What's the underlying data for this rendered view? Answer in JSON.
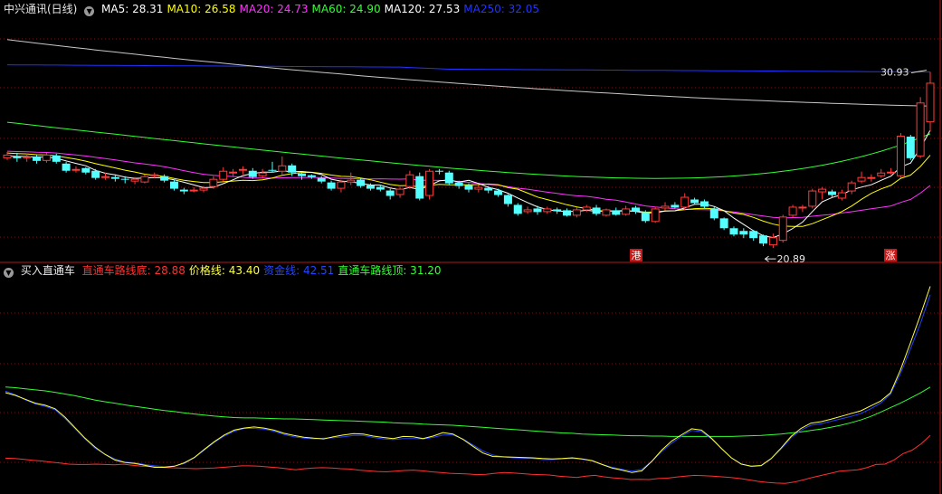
{
  "panel1": {
    "title": "中兴通讯(日线)",
    "ma": [
      {
        "label": "MA5: 28.31",
        "color": "#ffffff"
      },
      {
        "label": "MA10: 26.58",
        "color": "#ffff00"
      },
      {
        "label": "MA20: 24.73",
        "color": "#ff33ff"
      },
      {
        "label": "MA60: 24.90",
        "color": "#33ff33"
      },
      {
        "label": "MA120: 27.53",
        "color": "#ffffff"
      },
      {
        "label": "MA250: 32.05",
        "color": "#2233ff"
      }
    ],
    "high_marker": "30.93",
    "low_marker": "20.89",
    "badge_a": "港",
    "badge_b": "涨"
  },
  "panel2": {
    "title": "买入直通车",
    "lines": [
      {
        "label": "直通车路线底: 28.88",
        "color": "#ff3030"
      },
      {
        "label": "价格线: 43.40",
        "color": "#ffff44"
      },
      {
        "label": "资金线: 42.51",
        "color": "#2244ff"
      },
      {
        "label": "直通车路线顶: 31.20",
        "color": "#33ff33"
      }
    ]
  },
  "colors": {
    "up": "#ff3b3b",
    "down": "#54ffff",
    "grid": "#7a1010",
    "separator": "#b01818",
    "ma5": "#ffffff",
    "ma10": "#ffff00",
    "ma20": "#ff33ff",
    "ma60": "#33ff33",
    "ma120": "#c8c8c8",
    "ma250": "#2233ff",
    "route_bottom": "#ff3030",
    "price_line": "#ffff44",
    "money_line": "#2244ff",
    "route_top": "#33ff33"
  },
  "chart_data": [
    {
      "type": "candlestick",
      "title": "中兴通讯(日线)",
      "ylim": [
        19.5,
        33.0
      ],
      "candles": [
        [
          25.2,
          25.4,
          25.55,
          25.1
        ],
        [
          25.3,
          25.2,
          25.5,
          25.0
        ],
        [
          25.2,
          25.3,
          25.45,
          25.0
        ],
        [
          25.3,
          25.05,
          25.4,
          24.9
        ],
        [
          25.05,
          25.4,
          25.5,
          24.95
        ],
        [
          25.35,
          25.0,
          25.45,
          24.9
        ],
        [
          24.9,
          24.5,
          25.0,
          24.4
        ],
        [
          24.5,
          24.6,
          24.75,
          24.4
        ],
        [
          24.65,
          24.4,
          24.7,
          24.3
        ],
        [
          24.5,
          24.1,
          24.6,
          24.0
        ],
        [
          24.1,
          24.2,
          24.4,
          24.0
        ],
        [
          24.15,
          24.05,
          24.3,
          23.9
        ],
        [
          24.05,
          24.0,
          24.2,
          23.8
        ],
        [
          23.9,
          24.05,
          24.15,
          23.75
        ],
        [
          23.85,
          24.2,
          24.3,
          23.8
        ],
        [
          24.2,
          24.3,
          24.4,
          24.1
        ],
        [
          24.2,
          23.95,
          24.3,
          23.85
        ],
        [
          23.9,
          23.5,
          24.0,
          23.4
        ],
        [
          23.45,
          23.35,
          23.55,
          23.2
        ],
        [
          23.35,
          23.45,
          23.6,
          23.3
        ],
        [
          23.4,
          23.55,
          23.65,
          23.3
        ],
        [
          23.6,
          24.05,
          24.2,
          23.5
        ],
        [
          24.0,
          24.5,
          24.7,
          23.9
        ],
        [
          24.4,
          24.45,
          24.6,
          24.2
        ],
        [
          24.55,
          24.6,
          24.75,
          24.3
        ],
        [
          24.5,
          24.15,
          24.65,
          24.05
        ],
        [
          24.2,
          24.4,
          24.6,
          24.1
        ],
        [
          24.55,
          24.5,
          25.0,
          24.4
        ],
        [
          24.45,
          24.8,
          25.3,
          24.3
        ],
        [
          24.8,
          24.4,
          24.9,
          24.2
        ],
        [
          24.35,
          24.2,
          24.45,
          24.0
        ],
        [
          24.25,
          24.15,
          24.3,
          24.05
        ],
        [
          24.1,
          23.9,
          24.2,
          23.8
        ],
        [
          23.85,
          23.5,
          23.95,
          23.4
        ],
        [
          23.5,
          23.9,
          24.0,
          23.3
        ],
        [
          23.85,
          24.0,
          24.4,
          23.7
        ],
        [
          24.0,
          23.65,
          24.1,
          23.55
        ],
        [
          23.7,
          23.5,
          23.8,
          23.4
        ],
        [
          23.6,
          23.45,
          23.7,
          23.35
        ],
        [
          23.4,
          23.1,
          23.5,
          22.9
        ],
        [
          23.15,
          23.5,
          23.6,
          23.0
        ],
        [
          23.6,
          24.3,
          24.5,
          23.5
        ],
        [
          24.2,
          22.95,
          24.4,
          22.85
        ],
        [
          23.1,
          24.5,
          24.6,
          22.9
        ],
        [
          24.5,
          24.45,
          24.6,
          24.3
        ],
        [
          24.4,
          23.8,
          24.5,
          23.7
        ],
        [
          23.85,
          23.65,
          23.95,
          23.5
        ],
        [
          23.7,
          23.45,
          23.8,
          23.3
        ],
        [
          23.45,
          23.6,
          23.7,
          23.3
        ],
        [
          23.55,
          23.4,
          23.65,
          23.25
        ],
        [
          23.4,
          23.15,
          23.5,
          23.05
        ],
        [
          23.15,
          22.65,
          23.2,
          22.5
        ],
        [
          22.6,
          22.1,
          22.7,
          22.0
        ],
        [
          22.2,
          22.35,
          22.5,
          22.1
        ],
        [
          22.4,
          22.2,
          22.55,
          22.05
        ],
        [
          22.2,
          22.4,
          22.5,
          22.1
        ],
        [
          22.35,
          22.25,
          22.45,
          22.1
        ],
        [
          22.3,
          22.0,
          22.4,
          21.95
        ],
        [
          22.0,
          22.35,
          22.45,
          21.9
        ],
        [
          22.3,
          22.5,
          22.6,
          22.2
        ],
        [
          22.45,
          22.1,
          22.6,
          22.0
        ],
        [
          22.0,
          22.35,
          22.4,
          21.95
        ],
        [
          22.3,
          22.05,
          22.45,
          22.0
        ],
        [
          22.05,
          22.4,
          22.55,
          22.0
        ],
        [
          22.45,
          22.25,
          22.55,
          22.1
        ],
        [
          22.2,
          21.7,
          22.3,
          21.6
        ],
        [
          21.65,
          22.4,
          22.5,
          21.6
        ],
        [
          22.4,
          22.55,
          22.75,
          22.3
        ],
        [
          22.6,
          22.45,
          22.75,
          22.4
        ],
        [
          22.45,
          23.05,
          23.25,
          22.3
        ],
        [
          22.9,
          22.7,
          23.0,
          22.6
        ],
        [
          22.8,
          22.5,
          22.9,
          22.4
        ],
        [
          22.4,
          21.85,
          22.5,
          21.75
        ],
        [
          21.85,
          21.3,
          21.9,
          21.2
        ],
        [
          21.3,
          20.95,
          21.4,
          20.85
        ],
        [
          21.15,
          20.95,
          21.3,
          20.75
        ],
        [
          21.15,
          20.75,
          21.2,
          20.6
        ],
        [
          20.9,
          20.45,
          20.95,
          20.3
        ],
        [
          20.35,
          20.8,
          21.0,
          20.2
        ],
        [
          20.6,
          21.95,
          22.05,
          20.5
        ],
        [
          22.0,
          22.5,
          22.6,
          21.9
        ],
        [
          22.4,
          22.5,
          22.6,
          22.2
        ],
        [
          22.5,
          23.4,
          23.5,
          22.4
        ],
        [
          23.3,
          23.5,
          23.6,
          22.9
        ],
        [
          23.35,
          23.15,
          23.45,
          23.0
        ],
        [
          22.95,
          23.3,
          23.45,
          22.85
        ],
        [
          23.35,
          23.85,
          23.95,
          23.2
        ],
        [
          23.9,
          24.15,
          24.45,
          23.8
        ],
        [
          24.1,
          24.15,
          24.3,
          23.9
        ],
        [
          24.2,
          24.4,
          24.6,
          24.1
        ],
        [
          24.4,
          24.45,
          24.65,
          24.3
        ],
        [
          24.2,
          26.45,
          26.6,
          24.1
        ],
        [
          26.4,
          25.2,
          26.5,
          25.1
        ],
        [
          25.3,
          28.3,
          28.6,
          25.2
        ],
        [
          27.2,
          29.4,
          30.0,
          26.7
        ]
      ]
    },
    {
      "type": "line",
      "title": "买入直通车",
      "series": [
        {
          "name": "直通车路线底",
          "values": [
            17.7,
            17.6,
            17.4,
            17.1,
            16.9,
            16.6,
            16.3,
            16.0,
            15.9,
            15.9,
            16.0,
            15.9,
            15.8,
            16.0,
            15.7,
            15.4,
            15.3,
            15.1,
            15.0,
            14.9,
            14.8,
            14.7,
            14.8,
            14.9,
            15.1,
            15.3,
            15.5,
            15.5,
            15.4,
            15.2,
            15.0,
            14.7,
            14.4,
            14.7,
            14.9,
            15.0,
            14.9,
            14.7,
            14.6,
            14.3,
            14.1,
            13.9,
            13.8,
            14.0,
            14.2,
            14.3,
            14.1,
            13.8,
            13.6,
            13.4,
            13.3,
            13.2,
            13.0,
            13.1,
            13.4,
            13.6,
            13.5,
            13.3,
            13.1,
            13.0,
            12.9,
            12.6,
            12.4,
            12.2,
            12.6,
            12.8,
            12.4,
            12.1,
            11.9,
            11.6,
            11.7,
            11.6,
            11.9,
            12.0,
            12.3,
            12.6,
            12.8,
            12.7,
            12.6,
            12.4,
            12.2,
            11.9,
            11.5,
            11.1,
            10.8,
            10.6,
            10.5,
            10.9,
            11.5,
            12.2,
            12.8,
            13.4,
            14.0,
            14.2,
            14.4,
            15.0,
            15.9,
            16.0,
            17.2,
            19.0,
            20.0,
            21.8,
            24.2
          ]
        },
        {
          "name": "价格线",
          "values": [
            36.4,
            35.6,
            34.5,
            33.4,
            32.8,
            31.8,
            29.4,
            26.4,
            23.4,
            20.9,
            18.8,
            17.2,
            16.5,
            16.2,
            15.7,
            15.1,
            15.1,
            15.4,
            16.4,
            17.9,
            20.2,
            22.4,
            24.3,
            25.7,
            26.3,
            26.6,
            26.3,
            25.7,
            24.8,
            24.2,
            23.7,
            23.4,
            23.2,
            23.8,
            24.3,
            24.7,
            24.6,
            24.0,
            23.6,
            23.3,
            23.9,
            23.8,
            23.3,
            24.0,
            25.0,
            24.6,
            23.1,
            21.1,
            19.2,
            18.2,
            18.1,
            18.0,
            17.9,
            17.8,
            17.6,
            17.5,
            17.6,
            17.8,
            17.5,
            17.0,
            15.9,
            14.9,
            14.3,
            13.6,
            14.1,
            16.8,
            20.0,
            22.6,
            24.4,
            26.1,
            25.7,
            23.4,
            20.5,
            17.8,
            16.0,
            15.4,
            15.6,
            17.6,
            20.6,
            23.9,
            26.2,
            27.7,
            28.1,
            28.8,
            29.6,
            30.4,
            31.2,
            32.6,
            34.0,
            36.3,
            42.8,
            50.5,
            58.4,
            66.7
          ]
        },
        {
          "name": "资金线",
          "values": [
            36.8,
            35.8,
            34.3,
            33.2,
            32.5,
            31.5,
            29.0,
            26.1,
            23.2,
            20.6,
            18.8,
            17.5,
            16.6,
            16.4,
            15.9,
            15.5,
            15.3,
            15.4,
            16.2,
            17.8,
            20.0,
            22.2,
            24.0,
            25.4,
            26.2,
            26.2,
            26.0,
            25.4,
            24.5,
            23.8,
            23.4,
            23.2,
            23.4,
            23.5,
            23.8,
            24.2,
            24.2,
            23.6,
            23.2,
            23.0,
            23.3,
            23.3,
            23.2,
            23.6,
            24.3,
            24.3,
            23.2,
            21.5,
            19.8,
            18.6,
            18.1,
            17.8,
            17.7,
            17.6,
            17.3,
            17.3,
            17.5,
            17.6,
            17.4,
            16.9,
            15.9,
            15.1,
            14.5,
            14.0,
            14.5,
            16.8,
            19.6,
            22.0,
            24.0,
            25.6,
            25.3,
            23.2,
            20.5,
            17.8,
            16.1,
            15.3,
            15.5,
            17.5,
            20.3,
            23.5,
            25.7,
            27.1,
            27.5,
            28.2,
            28.9,
            29.6,
            30.4,
            31.8,
            33.4,
            35.9,
            41.8,
            48.8,
            56.0,
            64.3
          ]
        },
        {
          "name": "直通车路线顶",
          "values": [
            38.0,
            37.8,
            37.5,
            37.2,
            36.9,
            36.5,
            36.0,
            35.5,
            34.9,
            34.3,
            33.8,
            33.4,
            32.9,
            32.5,
            32.1,
            31.7,
            31.3,
            31.0,
            30.6,
            30.3,
            30.0,
            29.7,
            29.5,
            29.3,
            29.2,
            29.2,
            29.1,
            29.0,
            28.9,
            28.9,
            28.8,
            28.7,
            28.6,
            28.5,
            28.4,
            28.3,
            28.2,
            28.1,
            28.0,
            27.8,
            27.7,
            27.6,
            27.4,
            27.3,
            27.2,
            27.1,
            26.9,
            26.7,
            26.5,
            26.3,
            26.1,
            25.9,
            25.7,
            25.5,
            25.3,
            25.1,
            24.9,
            24.8,
            24.6,
            24.5,
            24.4,
            24.3,
            24.2,
            24.1,
            24.1,
            24.0,
            24.0,
            23.9,
            23.9,
            23.9,
            23.9,
            23.9,
            23.9,
            23.9,
            24.0,
            24.1,
            24.2,
            24.4,
            24.6,
            24.9,
            25.2,
            25.6,
            26.0,
            26.5,
            27.1,
            27.8,
            28.6,
            29.6,
            30.8,
            32.1,
            33.4,
            34.8,
            36.3,
            38.0
          ]
        }
      ]
    }
  ]
}
